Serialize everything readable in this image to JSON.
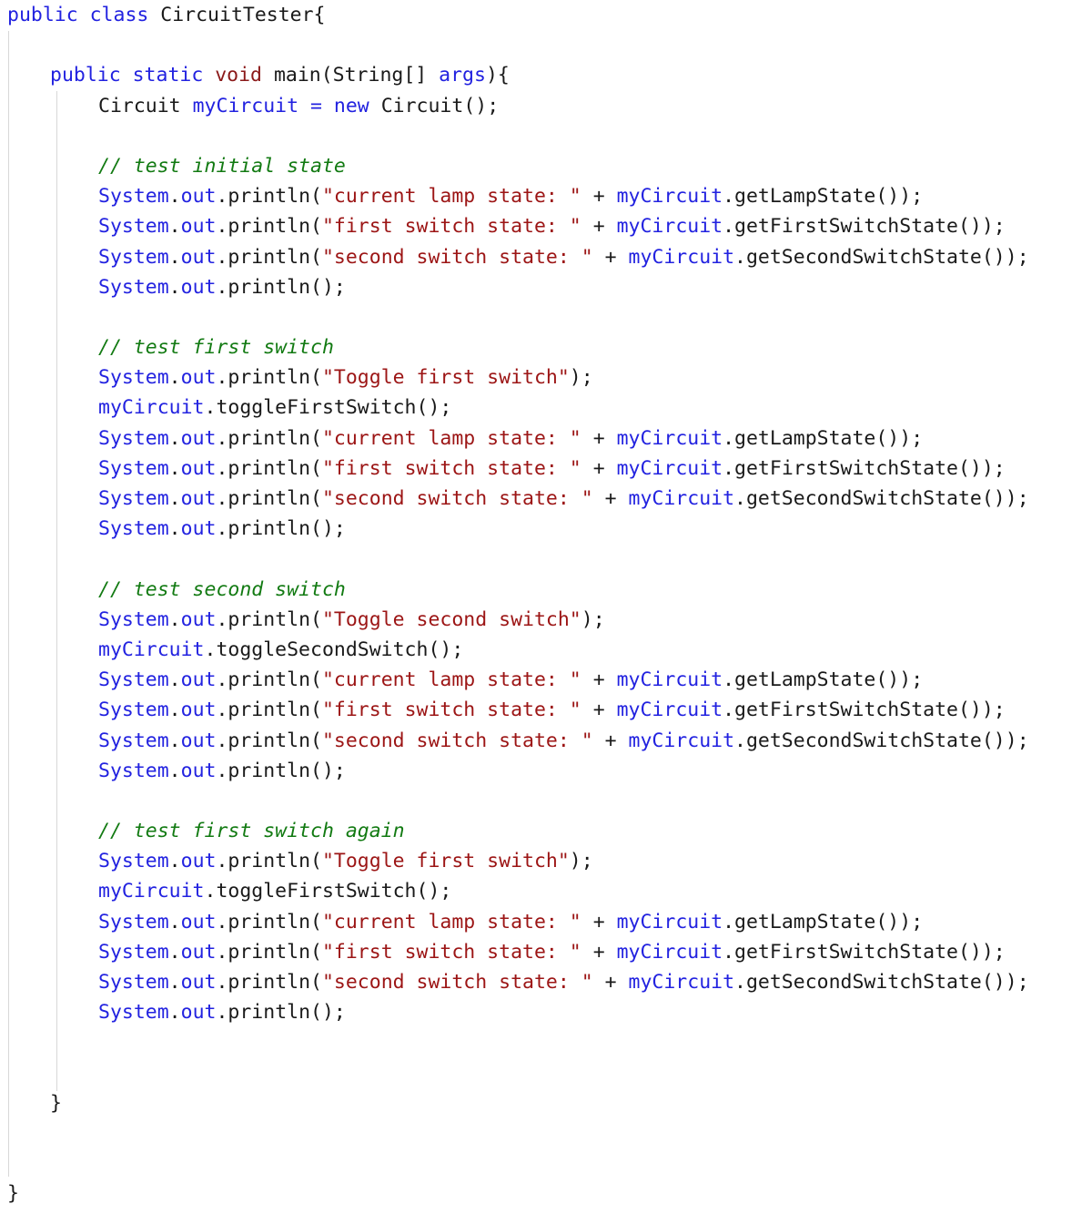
{
  "editor": {
    "language": "java",
    "file_title": "CircuitTester",
    "theme": {
      "background": "#ffffff",
      "default_text": "#1a1a1a",
      "keyword": "#2222e0",
      "type_keyword": "#8b1a1a",
      "variable": "#2222e0",
      "string": "#9c1515",
      "comment": "#127a12",
      "indent_guide": "#d8d8d8"
    }
  },
  "code": {
    "lines": [
      {
        "id": "l01",
        "indent": 0,
        "tokens": [
          {
            "t": "public class ",
            "c": "kw"
          },
          {
            "t": "CircuitTester{",
            "c": "ident"
          }
        ]
      },
      {
        "id": "l02",
        "indent": 0,
        "tokens": []
      },
      {
        "id": "l03",
        "indent": 1,
        "tokens": [
          {
            "t": "public static ",
            "c": "kw"
          },
          {
            "t": "void",
            "c": "kwr"
          },
          {
            "t": " main(String[] ",
            "c": "ident"
          },
          {
            "t": "args",
            "c": "kw"
          },
          {
            "t": "){",
            "c": "ident"
          }
        ]
      },
      {
        "id": "l04",
        "indent": 2,
        "tokens": [
          {
            "t": "Circuit ",
            "c": "ident"
          },
          {
            "t": "myCircuit",
            "c": "var"
          },
          {
            "t": " ",
            "c": "ident"
          },
          {
            "t": "=",
            "c": "kw"
          },
          {
            "t": " ",
            "c": "ident"
          },
          {
            "t": "new",
            "c": "kw"
          },
          {
            "t": " Circuit();",
            "c": "ident"
          }
        ]
      },
      {
        "id": "l05",
        "indent": 0,
        "tokens": []
      },
      {
        "id": "l06",
        "indent": 2,
        "tokens": [
          {
            "t": "// test initial state",
            "c": "cmt"
          }
        ]
      },
      {
        "id": "l07",
        "indent": 2,
        "tokens": [
          {
            "t": "System",
            "c": "var"
          },
          {
            "t": ".",
            "c": "ident"
          },
          {
            "t": "out",
            "c": "var"
          },
          {
            "t": ".println(",
            "c": "ident"
          },
          {
            "t": "\"current lamp state: \"",
            "c": "str"
          },
          {
            "t": " + ",
            "c": "ident"
          },
          {
            "t": "myCircuit",
            "c": "var"
          },
          {
            "t": ".getLampState());",
            "c": "ident"
          }
        ]
      },
      {
        "id": "l08",
        "indent": 2,
        "tokens": [
          {
            "t": "System",
            "c": "var"
          },
          {
            "t": ".",
            "c": "ident"
          },
          {
            "t": "out",
            "c": "var"
          },
          {
            "t": ".println(",
            "c": "ident"
          },
          {
            "t": "\"first switch state: \"",
            "c": "str"
          },
          {
            "t": " + ",
            "c": "ident"
          },
          {
            "t": "myCircuit",
            "c": "var"
          },
          {
            "t": ".getFirstSwitchState());",
            "c": "ident"
          }
        ]
      },
      {
        "id": "l09",
        "indent": 2,
        "tokens": [
          {
            "t": "System",
            "c": "var"
          },
          {
            "t": ".",
            "c": "ident"
          },
          {
            "t": "out",
            "c": "var"
          },
          {
            "t": ".println(",
            "c": "ident"
          },
          {
            "t": "\"second switch state: \"",
            "c": "str"
          },
          {
            "t": " + ",
            "c": "ident"
          },
          {
            "t": "myCircuit",
            "c": "var"
          },
          {
            "t": ".getSecondSwitchState());",
            "c": "ident"
          }
        ]
      },
      {
        "id": "l10",
        "indent": 2,
        "tokens": [
          {
            "t": "System",
            "c": "var"
          },
          {
            "t": ".",
            "c": "ident"
          },
          {
            "t": "out",
            "c": "var"
          },
          {
            "t": ".println();",
            "c": "ident"
          }
        ]
      },
      {
        "id": "l11",
        "indent": 0,
        "tokens": []
      },
      {
        "id": "l12",
        "indent": 2,
        "tokens": [
          {
            "t": "// test first switch",
            "c": "cmt"
          }
        ]
      },
      {
        "id": "l13",
        "indent": 2,
        "tokens": [
          {
            "t": "System",
            "c": "var"
          },
          {
            "t": ".",
            "c": "ident"
          },
          {
            "t": "out",
            "c": "var"
          },
          {
            "t": ".println(",
            "c": "ident"
          },
          {
            "t": "\"Toggle first switch\"",
            "c": "str"
          },
          {
            "t": ");",
            "c": "ident"
          }
        ]
      },
      {
        "id": "l14",
        "indent": 2,
        "tokens": [
          {
            "t": "myCircuit",
            "c": "var"
          },
          {
            "t": ".toggleFirstSwitch();",
            "c": "ident"
          }
        ]
      },
      {
        "id": "l15",
        "indent": 2,
        "tokens": [
          {
            "t": "System",
            "c": "var"
          },
          {
            "t": ".",
            "c": "ident"
          },
          {
            "t": "out",
            "c": "var"
          },
          {
            "t": ".println(",
            "c": "ident"
          },
          {
            "t": "\"current lamp state: \"",
            "c": "str"
          },
          {
            "t": " + ",
            "c": "ident"
          },
          {
            "t": "myCircuit",
            "c": "var"
          },
          {
            "t": ".getLampState());",
            "c": "ident"
          }
        ]
      },
      {
        "id": "l16",
        "indent": 2,
        "tokens": [
          {
            "t": "System",
            "c": "var"
          },
          {
            "t": ".",
            "c": "ident"
          },
          {
            "t": "out",
            "c": "var"
          },
          {
            "t": ".println(",
            "c": "ident"
          },
          {
            "t": "\"first switch state: \"",
            "c": "str"
          },
          {
            "t": " + ",
            "c": "ident"
          },
          {
            "t": "myCircuit",
            "c": "var"
          },
          {
            "t": ".getFirstSwitchState());",
            "c": "ident"
          }
        ]
      },
      {
        "id": "l17",
        "indent": 2,
        "tokens": [
          {
            "t": "System",
            "c": "var"
          },
          {
            "t": ".",
            "c": "ident"
          },
          {
            "t": "out",
            "c": "var"
          },
          {
            "t": ".println(",
            "c": "ident"
          },
          {
            "t": "\"second switch state: \"",
            "c": "str"
          },
          {
            "t": " + ",
            "c": "ident"
          },
          {
            "t": "myCircuit",
            "c": "var"
          },
          {
            "t": ".getSecondSwitchState());",
            "c": "ident"
          }
        ]
      },
      {
        "id": "l18",
        "indent": 2,
        "tokens": [
          {
            "t": "System",
            "c": "var"
          },
          {
            "t": ".",
            "c": "ident"
          },
          {
            "t": "out",
            "c": "var"
          },
          {
            "t": ".println();",
            "c": "ident"
          }
        ]
      },
      {
        "id": "l19",
        "indent": 0,
        "tokens": []
      },
      {
        "id": "l20",
        "indent": 2,
        "tokens": [
          {
            "t": "// test second switch",
            "c": "cmt"
          }
        ]
      },
      {
        "id": "l21",
        "indent": 2,
        "tokens": [
          {
            "t": "System",
            "c": "var"
          },
          {
            "t": ".",
            "c": "ident"
          },
          {
            "t": "out",
            "c": "var"
          },
          {
            "t": ".println(",
            "c": "ident"
          },
          {
            "t": "\"Toggle second switch\"",
            "c": "str"
          },
          {
            "t": ");",
            "c": "ident"
          }
        ]
      },
      {
        "id": "l22",
        "indent": 2,
        "tokens": [
          {
            "t": "myCircuit",
            "c": "var"
          },
          {
            "t": ".toggleSecondSwitch();",
            "c": "ident"
          }
        ]
      },
      {
        "id": "l23",
        "indent": 2,
        "tokens": [
          {
            "t": "System",
            "c": "var"
          },
          {
            "t": ".",
            "c": "ident"
          },
          {
            "t": "out",
            "c": "var"
          },
          {
            "t": ".println(",
            "c": "ident"
          },
          {
            "t": "\"current lamp state: \"",
            "c": "str"
          },
          {
            "t": " + ",
            "c": "ident"
          },
          {
            "t": "myCircuit",
            "c": "var"
          },
          {
            "t": ".getLampState());",
            "c": "ident"
          }
        ]
      },
      {
        "id": "l24",
        "indent": 2,
        "tokens": [
          {
            "t": "System",
            "c": "var"
          },
          {
            "t": ".",
            "c": "ident"
          },
          {
            "t": "out",
            "c": "var"
          },
          {
            "t": ".println(",
            "c": "ident"
          },
          {
            "t": "\"first switch state: \"",
            "c": "str"
          },
          {
            "t": " + ",
            "c": "ident"
          },
          {
            "t": "myCircuit",
            "c": "var"
          },
          {
            "t": ".getFirstSwitchState());",
            "c": "ident"
          }
        ]
      },
      {
        "id": "l25",
        "indent": 2,
        "tokens": [
          {
            "t": "System",
            "c": "var"
          },
          {
            "t": ".",
            "c": "ident"
          },
          {
            "t": "out",
            "c": "var"
          },
          {
            "t": ".println(",
            "c": "ident"
          },
          {
            "t": "\"second switch state: \"",
            "c": "str"
          },
          {
            "t": " + ",
            "c": "ident"
          },
          {
            "t": "myCircuit",
            "c": "var"
          },
          {
            "t": ".getSecondSwitchState());",
            "c": "ident"
          }
        ]
      },
      {
        "id": "l26",
        "indent": 2,
        "tokens": [
          {
            "t": "System",
            "c": "var"
          },
          {
            "t": ".",
            "c": "ident"
          },
          {
            "t": "out",
            "c": "var"
          },
          {
            "t": ".println();",
            "c": "ident"
          }
        ]
      },
      {
        "id": "l27",
        "indent": 0,
        "tokens": []
      },
      {
        "id": "l28",
        "indent": 2,
        "tokens": [
          {
            "t": "// test first switch again",
            "c": "cmt"
          }
        ]
      },
      {
        "id": "l29",
        "indent": 2,
        "tokens": [
          {
            "t": "System",
            "c": "var"
          },
          {
            "t": ".",
            "c": "ident"
          },
          {
            "t": "out",
            "c": "var"
          },
          {
            "t": ".println(",
            "c": "ident"
          },
          {
            "t": "\"Toggle first switch\"",
            "c": "str"
          },
          {
            "t": ");",
            "c": "ident"
          }
        ]
      },
      {
        "id": "l30",
        "indent": 2,
        "tokens": [
          {
            "t": "myCircuit",
            "c": "var"
          },
          {
            "t": ".toggleFirstSwitch();",
            "c": "ident"
          }
        ]
      },
      {
        "id": "l31",
        "indent": 2,
        "tokens": [
          {
            "t": "System",
            "c": "var"
          },
          {
            "t": ".",
            "c": "ident"
          },
          {
            "t": "out",
            "c": "var"
          },
          {
            "t": ".println(",
            "c": "ident"
          },
          {
            "t": "\"current lamp state: \"",
            "c": "str"
          },
          {
            "t": " + ",
            "c": "ident"
          },
          {
            "t": "myCircuit",
            "c": "var"
          },
          {
            "t": ".getLampState());",
            "c": "ident"
          }
        ]
      },
      {
        "id": "l32",
        "indent": 2,
        "tokens": [
          {
            "t": "System",
            "c": "var"
          },
          {
            "t": ".",
            "c": "ident"
          },
          {
            "t": "out",
            "c": "var"
          },
          {
            "t": ".println(",
            "c": "ident"
          },
          {
            "t": "\"first switch state: \"",
            "c": "str"
          },
          {
            "t": " + ",
            "c": "ident"
          },
          {
            "t": "myCircuit",
            "c": "var"
          },
          {
            "t": ".getFirstSwitchState());",
            "c": "ident"
          }
        ]
      },
      {
        "id": "l33",
        "indent": 2,
        "tokens": [
          {
            "t": "System",
            "c": "var"
          },
          {
            "t": ".",
            "c": "ident"
          },
          {
            "t": "out",
            "c": "var"
          },
          {
            "t": ".println(",
            "c": "ident"
          },
          {
            "t": "\"second switch state: \"",
            "c": "str"
          },
          {
            "t": " + ",
            "c": "ident"
          },
          {
            "t": "myCircuit",
            "c": "var"
          },
          {
            "t": ".getSecondSwitchState());",
            "c": "ident"
          }
        ]
      },
      {
        "id": "l34",
        "indent": 2,
        "tokens": [
          {
            "t": "System",
            "c": "var"
          },
          {
            "t": ".",
            "c": "ident"
          },
          {
            "t": "out",
            "c": "var"
          },
          {
            "t": ".println();",
            "c": "ident"
          }
        ]
      },
      {
        "id": "l35",
        "indent": 0,
        "tokens": []
      },
      {
        "id": "l36",
        "indent": 0,
        "tokens": []
      },
      {
        "id": "l37",
        "indent": 1,
        "tokens": [
          {
            "t": "}",
            "c": "ident"
          }
        ]
      },
      {
        "id": "l38",
        "indent": 0,
        "tokens": []
      },
      {
        "id": "l39",
        "indent": 0,
        "tokens": []
      },
      {
        "id": "l40",
        "indent": 0,
        "tokens": [
          {
            "t": "}",
            "c": "ident"
          }
        ]
      }
    ]
  }
}
